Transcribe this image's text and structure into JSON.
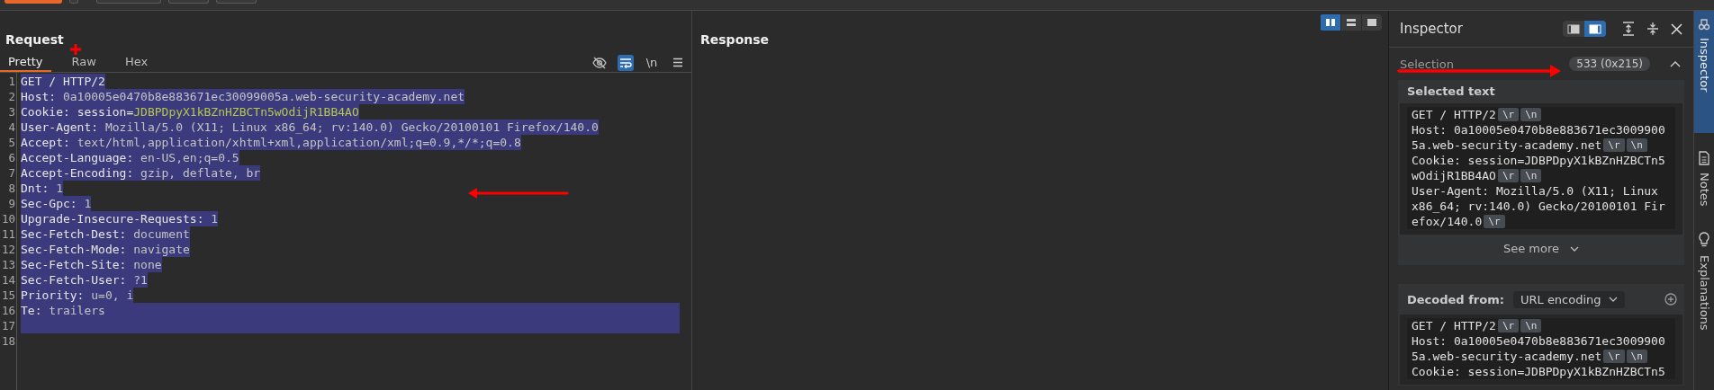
{
  "request": {
    "title": "Request",
    "tabs": [
      {
        "label": "Pretty",
        "selected": true
      },
      {
        "label": "Raw",
        "selected": false
      },
      {
        "label": "Hex",
        "selected": false
      }
    ],
    "tools": [
      {
        "kind": "hide",
        "selected": false
      },
      {
        "kind": "wrap",
        "selected": true
      },
      {
        "kind": "newline",
        "label": "\\n",
        "selected": false
      },
      {
        "kind": "menu",
        "selected": false
      }
    ],
    "lines": [
      {
        "number": "1",
        "selected": true,
        "full_width": false,
        "parts": [
          {
            "kind": "name",
            "text": "GET / HTTP/2"
          }
        ]
      },
      {
        "number": "2",
        "selected": true,
        "full_width": false,
        "parts": [
          {
            "kind": "name",
            "text": "Host: "
          },
          {
            "kind": "value",
            "text": "0a10005e0470b8e883671ec30099005a.web-security-academy.net"
          }
        ]
      },
      {
        "number": "3",
        "selected": true,
        "full_width": false,
        "parts": [
          {
            "kind": "name",
            "text": "Cookie: "
          },
          {
            "kind": "name",
            "text": "session="
          },
          {
            "kind": "cookie",
            "text": "JDBPDpyX1kBZnHZBCTn5wOdijR1BB4AO"
          }
        ]
      },
      {
        "number": "4",
        "selected": true,
        "full_width": false,
        "parts": [
          {
            "kind": "name",
            "text": "User-Agent: "
          },
          {
            "kind": "value",
            "text": "Mozilla/5.0 (X11; Linux x86_64; rv:140.0) Gecko/20100101 Firefox/140.0"
          }
        ]
      },
      {
        "number": "5",
        "selected": true,
        "full_width": false,
        "parts": [
          {
            "kind": "name",
            "text": "Accept: "
          },
          {
            "kind": "value",
            "text": "text/html,application/xhtml+xml,application/xml;q=0.9,*/*;q=0.8"
          }
        ]
      },
      {
        "number": "6",
        "selected": true,
        "full_width": false,
        "parts": [
          {
            "kind": "name",
            "text": "Accept-Language: "
          },
          {
            "kind": "value",
            "text": "en-US,en;q=0.5"
          }
        ]
      },
      {
        "number": "7",
        "selected": true,
        "full_width": false,
        "parts": [
          {
            "kind": "name",
            "text": "Accept-Encoding: "
          },
          {
            "kind": "value",
            "text": "gzip, deflate, br"
          }
        ]
      },
      {
        "number": "8",
        "selected": true,
        "full_width": false,
        "parts": [
          {
            "kind": "name",
            "text": "Dnt: "
          },
          {
            "kind": "value",
            "text": "1"
          }
        ]
      },
      {
        "number": "9",
        "selected": true,
        "full_width": false,
        "parts": [
          {
            "kind": "name",
            "text": "Sec-Gpc: "
          },
          {
            "kind": "value",
            "text": "1"
          }
        ]
      },
      {
        "number": "10",
        "selected": true,
        "full_width": false,
        "parts": [
          {
            "kind": "name",
            "text": "Upgrade-Insecure-Requests: "
          },
          {
            "kind": "value",
            "text": "1"
          }
        ]
      },
      {
        "number": "11",
        "selected": true,
        "full_width": false,
        "parts": [
          {
            "kind": "name",
            "text": "Sec-Fetch-Dest: "
          },
          {
            "kind": "value",
            "text": "document"
          }
        ]
      },
      {
        "number": "12",
        "selected": true,
        "full_width": false,
        "parts": [
          {
            "kind": "name",
            "text": "Sec-Fetch-Mode: "
          },
          {
            "kind": "value",
            "text": "navigate"
          }
        ]
      },
      {
        "number": "13",
        "selected": true,
        "full_width": false,
        "parts": [
          {
            "kind": "name",
            "text": "Sec-Fetch-Site: "
          },
          {
            "kind": "value",
            "text": "none"
          }
        ]
      },
      {
        "number": "14",
        "selected": true,
        "full_width": false,
        "parts": [
          {
            "kind": "name",
            "text": "Sec-Fetch-User: "
          },
          {
            "kind": "value",
            "text": "?1"
          }
        ]
      },
      {
        "number": "15",
        "selected": true,
        "full_width": false,
        "parts": [
          {
            "kind": "name",
            "text": "Priority: "
          },
          {
            "kind": "value",
            "text": "u=0, i"
          }
        ]
      },
      {
        "number": "16",
        "selected": true,
        "full_width": true,
        "parts": [
          {
            "kind": "name",
            "text": "Te: "
          },
          {
            "kind": "value",
            "text": "trailers"
          }
        ]
      },
      {
        "number": "17",
        "selected": true,
        "full_width": true
      },
      {
        "number": "18",
        "selected": false
      }
    ]
  },
  "response": {
    "title": "Response",
    "layouts": [
      {
        "kind": "columns",
        "selected": true
      },
      {
        "kind": "rows",
        "selected": false
      },
      {
        "kind": "single",
        "selected": false
      }
    ]
  },
  "inspector": {
    "title": "Inspector",
    "layouts": [
      {
        "kind": "left",
        "selected": false
      },
      {
        "kind": "right",
        "selected": true
      }
    ],
    "selection": {
      "label": "Selection",
      "count": "533 (0x215)",
      "expanded": true
    },
    "selected_text": {
      "title": "Selected text",
      "more": "See more",
      "lines": [
        {
          "text": "GET / HTTP/2",
          "marks": [
            "\\r",
            "\\n"
          ]
        },
        {
          "text": "Host: 0a10005e0470b8e883671ec3009900"
        },
        {
          "text": "5a.web-security-academy.net",
          "marks": [
            "\\r",
            "\\n"
          ]
        },
        {
          "text": "Cookie: session=JDBPDpyX1kBZnHZBCTn5"
        },
        {
          "text": "wOdijR1BB4AO",
          "marks": [
            "\\r",
            "\\n"
          ]
        },
        {
          "text": "User-Agent: Mozilla/5.0 (X11; Linux"
        },
        {
          "text": "x86_64; rv:140.0) Gecko/20100101 Fir"
        },
        {
          "text": "efox/140.0",
          "marks": [
            "\\r"
          ]
        }
      ]
    },
    "decoded": {
      "label": "Decoded from:",
      "encoding": "URL encoding",
      "lines": [
        {
          "text": "GET / HTTP/2",
          "marks": [
            "\\r",
            "\\n"
          ]
        },
        {
          "text": "Host: 0a10005e0470b8e883671ec3009900"
        },
        {
          "text": "5a.web-security-academy.net",
          "marks": [
            "\\r",
            "\\n"
          ]
        },
        {
          "text": "Cookie: session=JDBPDpyX1kBZnHZBCTn5"
        }
      ]
    }
  },
  "side_tabs": [
    {
      "kind": "inspector",
      "label": "Inspector",
      "selected": true
    },
    {
      "kind": "notes",
      "label": "Notes",
      "selected": false
    },
    {
      "kind": "explanations",
      "label": "Explanations",
      "selected": false
    }
  ]
}
